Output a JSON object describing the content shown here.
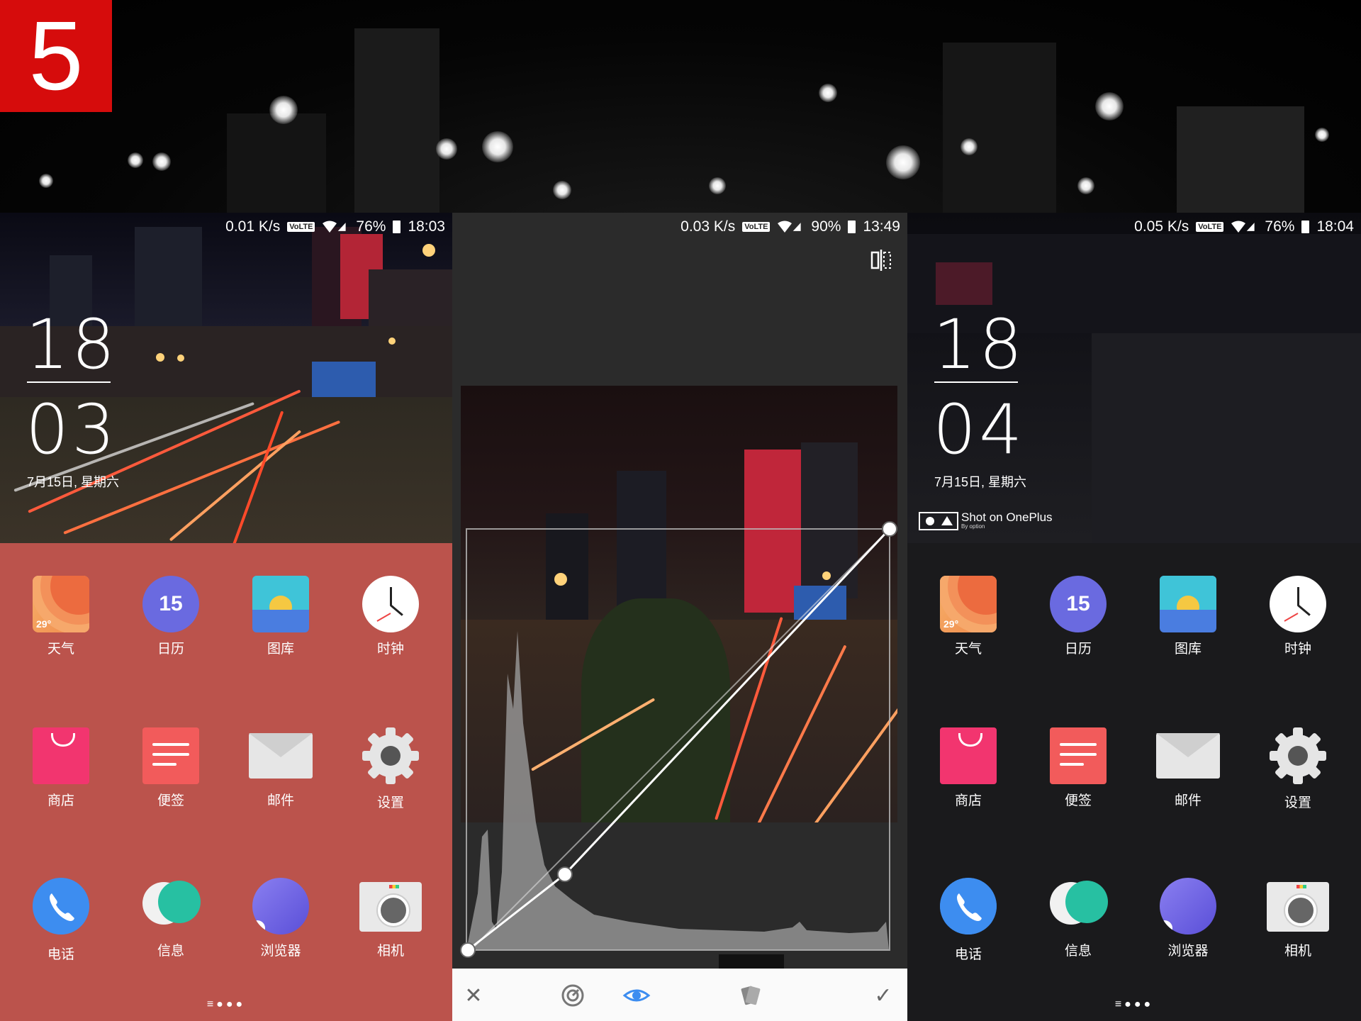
{
  "badge": "5",
  "panel1": {
    "status": {
      "speed": "0.01 K/s",
      "volte": "VoLTE",
      "battery": "76%",
      "time": "18:03"
    },
    "clock": {
      "hour": "18",
      "minute": "03",
      "date": "7月15日, 星期六"
    },
    "apps": [
      {
        "label": "天气",
        "icon": "weather-icon",
        "temp": "29°"
      },
      {
        "label": "日历",
        "icon": "calendar-icon",
        "day": "15"
      },
      {
        "label": "图库",
        "icon": "gallery-icon"
      },
      {
        "label": "时钟",
        "icon": "clock-icon"
      },
      {
        "label": "商店",
        "icon": "store-icon"
      },
      {
        "label": "便签",
        "icon": "notes-icon"
      },
      {
        "label": "邮件",
        "icon": "mail-icon"
      },
      {
        "label": "设置",
        "icon": "settings-icon"
      },
      {
        "label": "电话",
        "icon": "phone-icon"
      },
      {
        "label": "信息",
        "icon": "messages-icon"
      },
      {
        "label": "浏览器",
        "icon": "browser-icon"
      },
      {
        "label": "相机",
        "icon": "camera-icon"
      }
    ]
  },
  "panel2": {
    "status": {
      "speed": "0.03 K/s",
      "volte": "VoLTE",
      "battery": "90%",
      "time": "13:49"
    },
    "curve_points": [
      [
        0.0,
        0.0
      ],
      [
        0.23,
        0.18
      ],
      [
        1.0,
        1.0
      ]
    ],
    "toolbar": {
      "cancel": "✕",
      "apply": "✓"
    }
  },
  "panel3": {
    "status": {
      "speed": "0.05 K/s",
      "volte": "VoLTE",
      "battery": "76%",
      "time": "18:04"
    },
    "clock": {
      "hour": "18",
      "minute": "04",
      "date": "7月15日, 星期六"
    },
    "watermark": {
      "text": "Shot on OnePlus",
      "sub": "By option"
    }
  },
  "colors": {
    "badge": "#d60c0c",
    "panel1_bg": "#bb534c",
    "panel3_bg": "#1a1a1c",
    "editor_bg": "#2b2b2b",
    "accent": "#3d8df0"
  }
}
